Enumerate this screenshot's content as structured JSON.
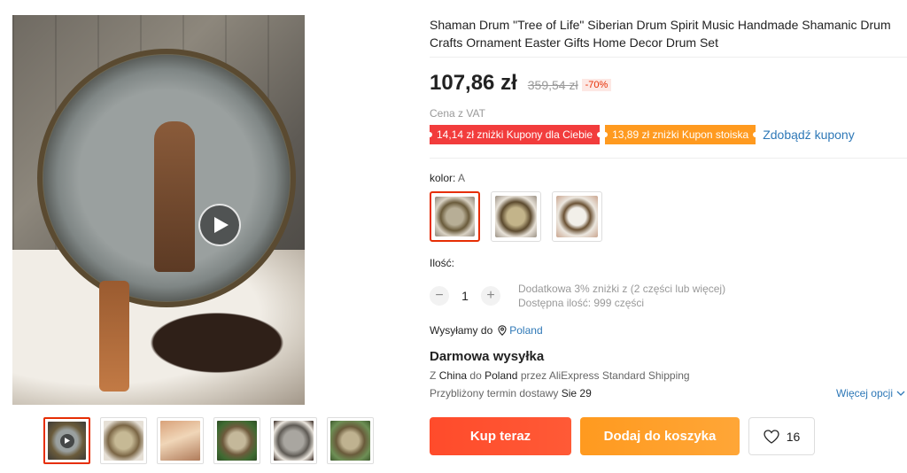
{
  "product": {
    "title": "Shaman Drum \"Tree of Life\" Siberian Drum Spirit Music Handmade Shamanic Drum Crafts Ornament Easter Gifts Home Decor Drum Set",
    "price": "107,86 zł",
    "old_price": "359,54 zł",
    "discount": "-70%",
    "vat_note": "Cena z VAT"
  },
  "coupons": [
    {
      "label": "14,14 zł zniżki Kupony dla Ciebie",
      "color": "#f23c3c"
    },
    {
      "label": "13,89 zł zniżki Kupon stoiska",
      "color": "#ff9a1f"
    }
  ],
  "get_coupons_label": "Zdobądź kupony",
  "color_option": {
    "label": "kolor:",
    "selected": "A",
    "swatches": [
      "A",
      "B",
      "C"
    ]
  },
  "quantity": {
    "label": "Ilość:",
    "value": "1",
    "minus": "−",
    "plus": "+",
    "note_line1": "Dodatkowa 3% zniżki z (2 części lub więcej)",
    "note_line2": "Dostępna ilość: 999 części"
  },
  "shipping": {
    "ship_to_label": "Wysyłamy do",
    "country": "Poland",
    "free_label": "Darmowa wysyłka",
    "from_prefix": "Z",
    "from": "China",
    "to_prefix": "do",
    "to": "Poland",
    "via_prefix": "przez",
    "method": "AliExpress Standard Shipping",
    "delivery_label": "Przybliżony termin dostawy",
    "delivery_date": "Sie 29",
    "more_options": "Więcej opcji"
  },
  "actions": {
    "buy_now": "Kup teraz",
    "add_to_cart": "Dodaj do koszyka",
    "wishlist_count": "16"
  },
  "gallery": {
    "thumbnail_count": 6,
    "active_index": 0
  },
  "colors": {
    "accent_red": "#e62e04",
    "link_blue": "#2e78b7",
    "buy_button": "#ff4b2b",
    "cart_button": "#ff9a1f"
  }
}
